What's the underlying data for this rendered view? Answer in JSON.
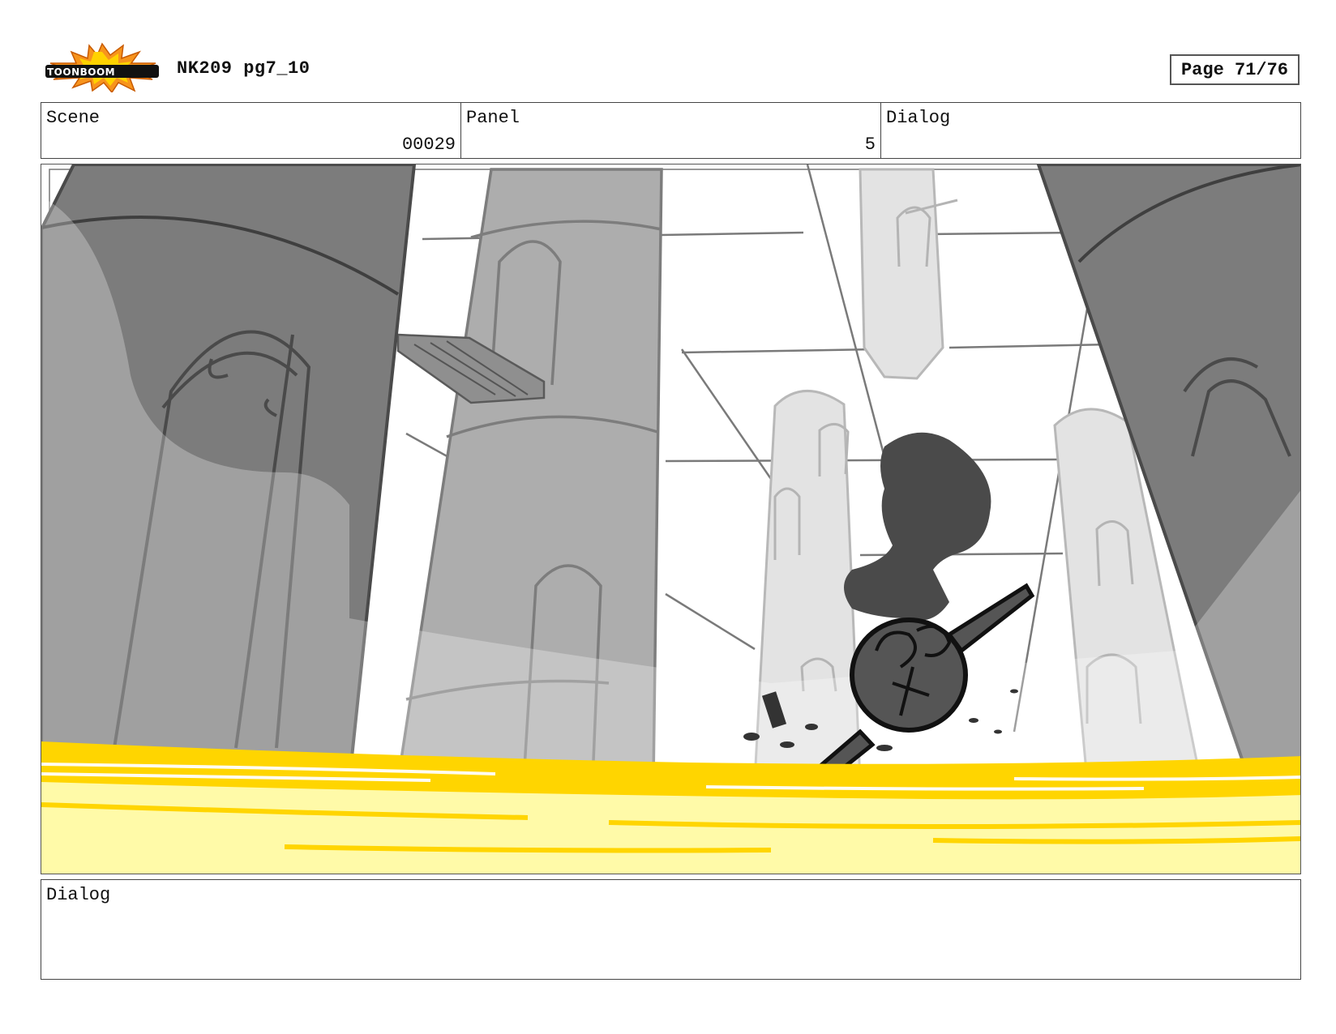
{
  "header": {
    "logo_text": "TOONBOOM",
    "title": "NK209 pg7_10",
    "page_label": "Page 71/76"
  },
  "info": {
    "scene_label": "Scene",
    "scene_value": "00029",
    "panel_label": "Panel",
    "panel_value": "5",
    "dialog_label": "Dialog",
    "dialog_value": ""
  },
  "dialog": {
    "label": "Dialog",
    "text": ""
  },
  "colors": {
    "liquid_gold": "#ffd500",
    "liquid_pale": "#fffaa8",
    "pillar_dark": "#7a7a7a",
    "pillar_mid": "#adadad",
    "pillar_light": "#e2e2e2",
    "smoke": "#4a4a4a"
  }
}
